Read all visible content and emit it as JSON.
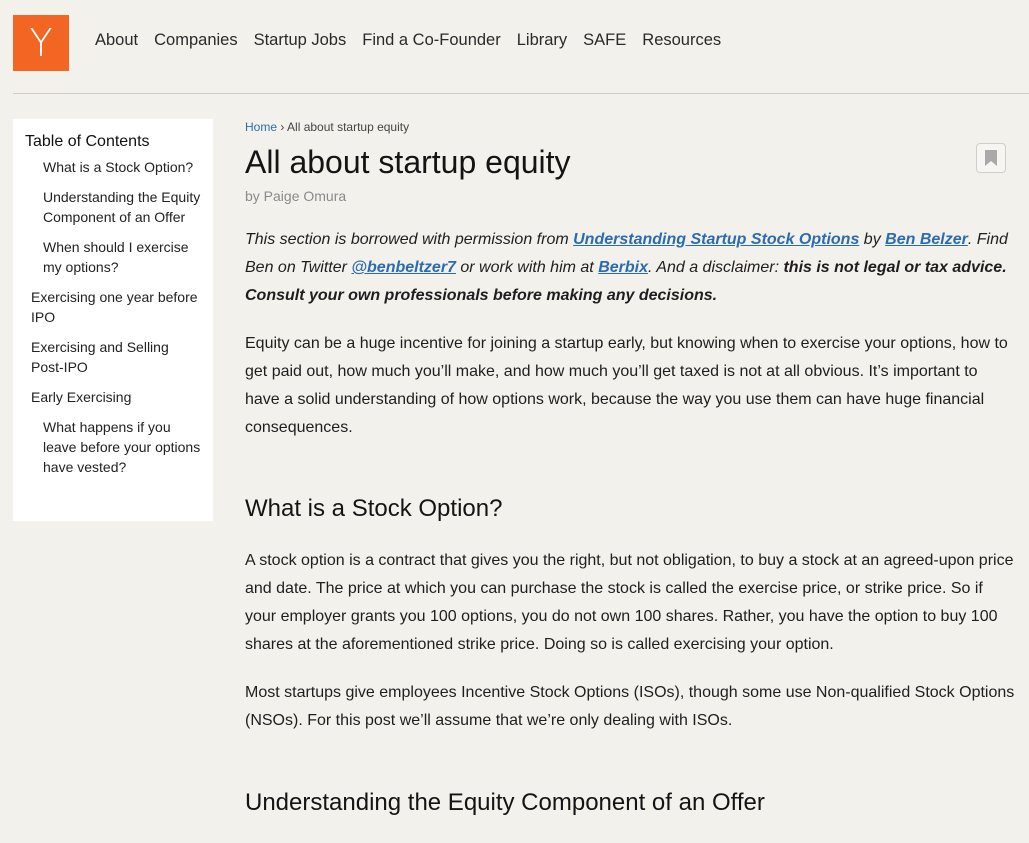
{
  "brand": {
    "logo_letter": "Y",
    "logo_color": "#f26522"
  },
  "nav": {
    "items": [
      "About",
      "Companies",
      "Startup Jobs",
      "Find a Co-Founder",
      "Library",
      "SAFE",
      "Resources"
    ]
  },
  "toc": {
    "title": "Table of Contents",
    "items": [
      {
        "label": "What is a Stock Option?",
        "level": 2
      },
      {
        "label": "Understanding the Equity Component of an Offer",
        "level": 2
      },
      {
        "label": "When should I exercise my options?",
        "level": 2
      },
      {
        "label": "Exercising one year before IPO",
        "level": 1
      },
      {
        "label": "Exercising and Selling Post-IPO",
        "level": 1
      },
      {
        "label": "Early Exercising",
        "level": 1
      },
      {
        "label": "What happens if you leave before your options have vested?",
        "level": 2
      }
    ]
  },
  "breadcrumb": {
    "home": "Home",
    "separator": "›",
    "current": "All about startup equity"
  },
  "article": {
    "title": "All about startup equity",
    "byline": "by Paige Omura",
    "bookmark_icon": "bookmark-icon",
    "intro": {
      "t1": "This section is borrowed with permission from ",
      "link1": "Understanding Startup Stock Options",
      "t2": " by ",
      "link2": "Ben Belzer",
      "t3": ". Find Ben on Twitter ",
      "link3": "@benbeltzer7",
      "t4": " or work with him at ",
      "link4": "Berbix",
      "t5": ". And a disclaimer: ",
      "bold": "this is not legal or tax advice. Consult your own professionals before making any decisions."
    },
    "p1": "Equity can be a huge incentive for joining a startup early, but knowing when to exercise your options, how to get paid out, how much you’ll make, and how much you’ll get taxed is not at all obvious. It’s important to have a solid understanding of how options work, because the way you use them can have huge financial consequences.",
    "h_stock_option": "What is a Stock Option?",
    "p2": "A stock option is a contract that gives you the right, but not obligation, to buy a stock at an agreed-upon price and date. The price at which you can purchase the stock is called the exercise price, or strike price. So if your employer grants you 100 options, you do not own 100 shares. Rather, you have the option to buy 100 shares at the aforementioned strike price. Doing so is called exercising your option.",
    "p3": "Most startups give employees Incentive Stock Options (ISOs), though some use Non-qualified Stock Options (NSOs). For this post we’ll assume that we’re only dealing with ISOs.",
    "h_equity_component": "Understanding the Equity Component of an Offer"
  },
  "colors": {
    "background": "#f3f1ec",
    "link": "#2b6cb0",
    "byline": "#8a8a8a"
  }
}
